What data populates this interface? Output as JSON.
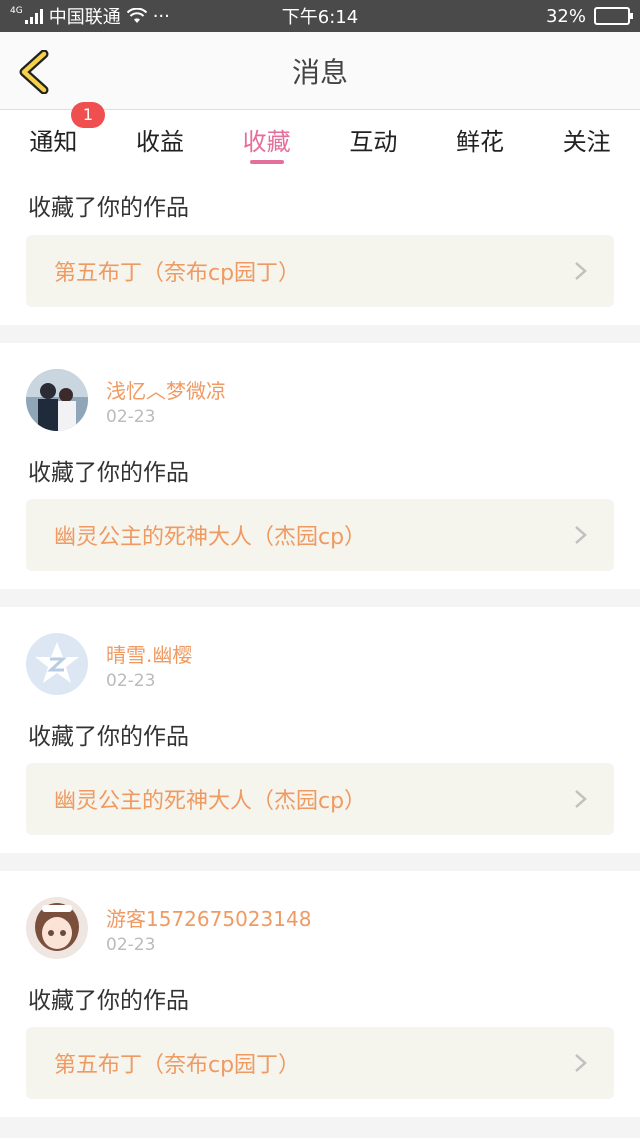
{
  "status_bar": {
    "network": "4G",
    "carrier": "中国联通",
    "dots": "···",
    "time": "下午6:14",
    "battery": "32%",
    "battery_level": 0.32
  },
  "header": {
    "title": "消息"
  },
  "tabs": [
    {
      "label": "通知",
      "badge": "1",
      "active": false
    },
    {
      "label": "收益",
      "active": false
    },
    {
      "label": "收藏",
      "active": true
    },
    {
      "label": "互动",
      "active": false
    },
    {
      "label": "鲜花",
      "active": false
    },
    {
      "label": "关注",
      "active": false
    }
  ],
  "colors": {
    "accent": "#e46f9b",
    "link": "#ef9a62",
    "badge": "#f04f4f",
    "work_bg": "#f5f4ed"
  },
  "items": [
    {
      "action": "收藏了你的作品",
      "work": "第五布丁（奈布cp园丁）"
    },
    {
      "user": "浅忆︿梦微凉",
      "date": "02-23",
      "avatar": "photo-avatar",
      "action": "收藏了你的作品",
      "work": "幽灵公主的死神大人（杰园cp）"
    },
    {
      "user": "晴雪.幽樱",
      "date": "02-23",
      "avatar": "default-star-avatar",
      "action": "收藏了你的作品",
      "work": "幽灵公主的死神大人（杰园cp）"
    },
    {
      "user": "游客1572675023148",
      "date": "02-23",
      "avatar": "anime-girl-avatar",
      "action": "收藏了你的作品",
      "work": "第五布丁（奈布cp园丁）"
    }
  ]
}
